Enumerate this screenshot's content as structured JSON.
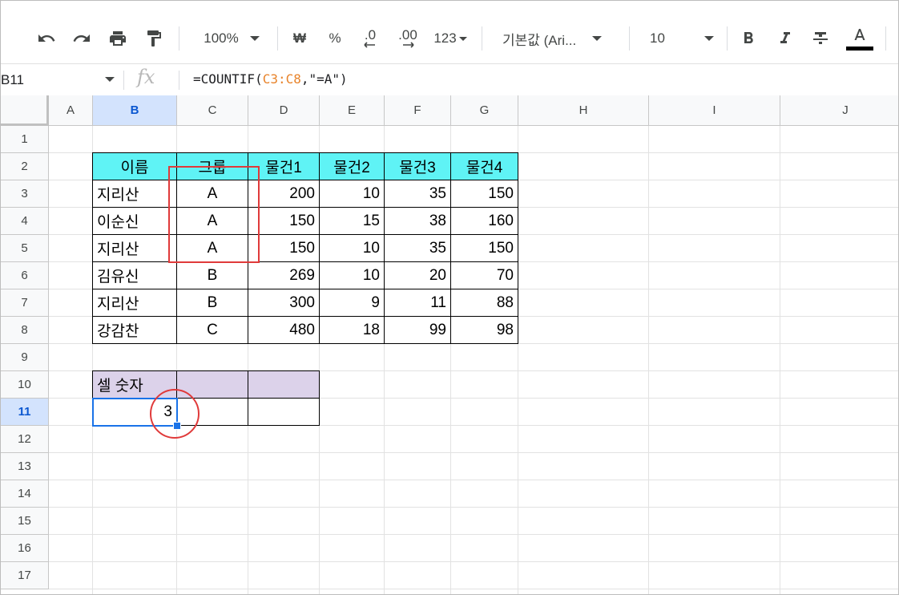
{
  "toolbar": {
    "zoom": "100%",
    "currency": "₩",
    "percent": "%",
    "decimal_decrease": ".0",
    "decimal_increase": ".00",
    "format_more": "123",
    "font": "기본값 (Ari...",
    "font_size": "10",
    "icons": [
      "undo-icon",
      "redo-icon",
      "print-icon",
      "paint-format-icon",
      "bold-icon",
      "italic-icon",
      "strikethrough-icon",
      "text-color-icon"
    ]
  },
  "formula_bar": {
    "name_box": "B11",
    "fx": "fx",
    "formula_prefix": "=COUNTIF(",
    "formula_range": "C3:C8",
    "formula_suffix": ",\"=A\")"
  },
  "columns": [
    "A",
    "B",
    "C",
    "D",
    "E",
    "F",
    "G",
    "H",
    "I",
    "J"
  ],
  "rows": [
    "1",
    "2",
    "3",
    "4",
    "5",
    "6",
    "7",
    "8",
    "9",
    "10",
    "11",
    "12",
    "13",
    "14",
    "15",
    "16",
    "17"
  ],
  "table": {
    "headers": [
      "이름",
      "그룹",
      "물건1",
      "물건2",
      "물건3",
      "물건4"
    ],
    "rows": [
      [
        "지리산",
        "A",
        "200",
        "10",
        "35",
        "150"
      ],
      [
        "이순신",
        "A",
        "150",
        "15",
        "38",
        "160"
      ],
      [
        "지리산",
        "A",
        "150",
        "10",
        "35",
        "150"
      ],
      [
        "김유신",
        "B",
        "269",
        "10",
        "20",
        "70"
      ],
      [
        "지리산",
        "B",
        "300",
        "9",
        "11",
        "88"
      ],
      [
        "강감찬",
        "C",
        "480",
        "18",
        "99",
        "98"
      ]
    ]
  },
  "count_box": {
    "label": "셀 숫자",
    "result": "3"
  },
  "selected_cell": "B11",
  "colors": {
    "header_fill": "#5ff3f5",
    "label_fill": "#dcd2ea",
    "selection": "#1a73e8",
    "annotation": "#e03a3a",
    "range_highlight": "#e8832a"
  }
}
